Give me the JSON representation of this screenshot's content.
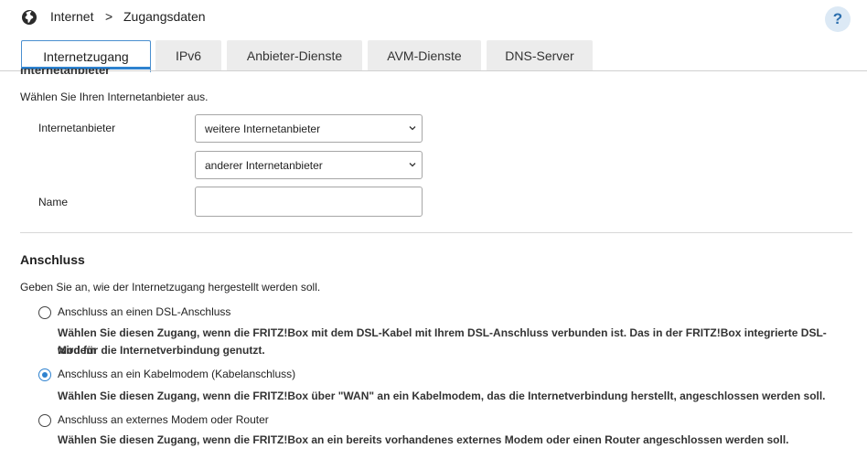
{
  "breadcrumb": {
    "home": "Internet",
    "separator": ">",
    "page": "Zugangsdaten"
  },
  "help": {
    "label": "?"
  },
  "tabs": [
    {
      "label": "Internetzugang",
      "active": true
    },
    {
      "label": "IPv6",
      "active": false
    },
    {
      "label": "Anbieter-Dienste",
      "active": false
    },
    {
      "label": "AVM-Dienste",
      "active": false
    },
    {
      "label": "DNS-Server",
      "active": false
    }
  ],
  "provider_section": {
    "heading": "Internetanbieter",
    "intro": "Wählen Sie Ihren Internetanbieter aus.",
    "provider_label": "Internetanbieter",
    "provider_select": "weitere Internetanbieter",
    "provider_subselect": "anderer Internetanbieter",
    "name_label": "Name",
    "name_value": ""
  },
  "connection_section": {
    "heading": "Anschluss",
    "description": "Geben Sie an, wie der Internetzugang hergestellt werden soll.",
    "options": [
      {
        "label": "Anschluss an einen DSL-Anschluss",
        "help_line1": "Wählen Sie diesen Zugang, wenn die FRITZ!Box mit dem DSL-Kabel mit Ihrem DSL-Anschluss verbunden ist. Das in der FRITZ!Box integrierte DSL-Modem",
        "help_line2": "wird für die Internetverbindung genutzt.",
        "checked": false
      },
      {
        "label": "Anschluss an ein Kabelmodem (Kabelanschluss)",
        "help_line1": "Wählen Sie diesen Zugang, wenn die FRITZ!Box über \"WAN\" an ein Kabelmodem, das die Internetverbindung herstellt, angeschlossen werden soll.",
        "checked": true
      },
      {
        "label": "Anschluss an externes Modem oder Router",
        "help_line1": "Wählen Sie diesen Zugang, wenn die FRITZ!Box an ein bereits vorhandenes externes Modem oder einen Router angeschlossen werden soll.",
        "checked": false
      }
    ]
  },
  "icons": {
    "globe": "globe-icon",
    "chevron": "chevron-down-icon"
  },
  "colors": {
    "accent": "#2e82cf",
    "tab_inactive": "#ececec",
    "help_bg": "#dce9f5"
  }
}
